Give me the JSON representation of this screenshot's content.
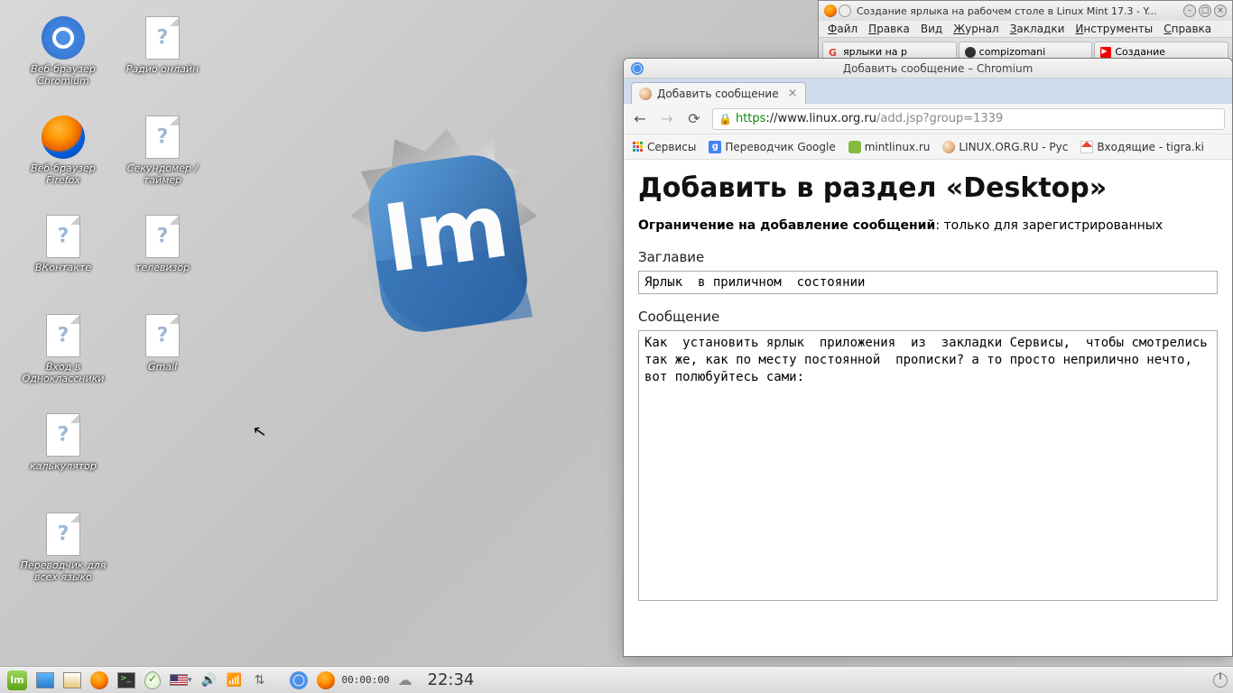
{
  "desktop_icons": {
    "chromium": "Веб-браузер Chromium",
    "firefox": "Веб-браузер Firefox",
    "vkontakte": "ВКонтакте",
    "odnoklassniki": "Вход в Одноклассники",
    "calculator": "калькулятор",
    "translator": "Переводчик для всех языко",
    "radio": "Радио онлайн",
    "stopwatch": "Секундомер / таймер",
    "tv": "телевизор",
    "gmail": "Gmail"
  },
  "firefox_window": {
    "title": "Создание ярлыка на рабочем столе в Linux Mint 17.3 - Y...",
    "menu": {
      "file": "Файл",
      "edit": "Правка",
      "view": "Вид",
      "journal": "Журнал",
      "bookmarks": "Закладки",
      "tools": "Инструменты",
      "help": "Справка"
    },
    "tabs": {
      "t1": "ярлыки на р",
      "t2": "compizomani",
      "t3": "Создание"
    }
  },
  "chromium_window": {
    "title": "Добавить сообщение – Chromium",
    "tab_label": "Добавить сообщение",
    "url": {
      "proto": "https",
      "host": "://www.linux.org.ru",
      "path": "/add.jsp?group=1339"
    },
    "bookmarks": {
      "apps": "Сервисы",
      "gtrans": "Переводчик Google",
      "mint": "mintlinux.ru",
      "lor": "LINUX.ORG.RU - Рус",
      "gmail": "Входящие - tigra.ki"
    },
    "page": {
      "heading": "Добавить в раздел «Desktop»",
      "restrict_b": "Ограничение на добавление сообщений",
      "restrict_rest": ": только для зарегистрированных",
      "label_title": "Заглавие",
      "input_title": "Ярлык  в приличном  состоянии",
      "label_msg": "Сообщение",
      "msg": "Как  установить ярлык  приложения  из  закладки Сервисы,  чтобы смотрелись так же, как по месту постоянной  прописки? а то просто неприлично нечто, вот полюбуйтесь сами:"
    }
  },
  "taskbar": {
    "timer": "00:00:00",
    "clock": "22:34"
  }
}
